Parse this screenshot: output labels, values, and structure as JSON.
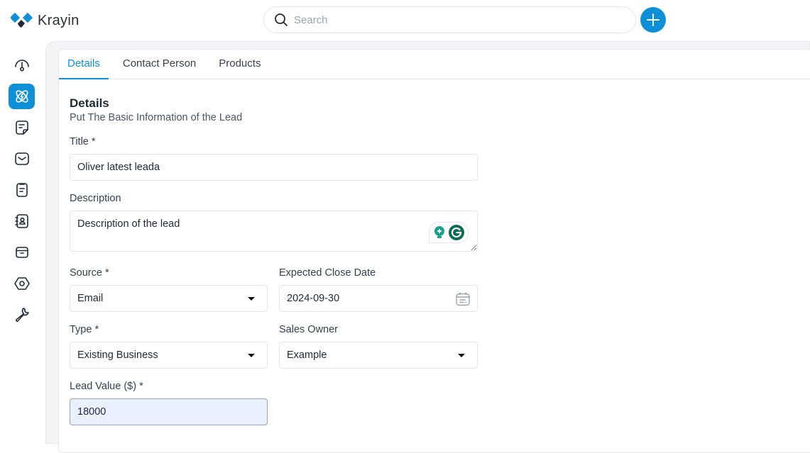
{
  "app": {
    "name": "Krayin"
  },
  "header": {
    "search_placeholder": "Search",
    "add_button": "plus-icon"
  },
  "sidebar": {
    "items": [
      {
        "name": "dashboard",
        "icon": "dashboard-gauge-icon",
        "active": false
      },
      {
        "name": "leads",
        "icon": "leads-atom-icon",
        "active": true
      },
      {
        "name": "quotes",
        "icon": "quote-note-icon",
        "active": false
      },
      {
        "name": "mail",
        "icon": "mail-icon",
        "active": false
      },
      {
        "name": "activities",
        "icon": "clipboard-icon",
        "active": false
      },
      {
        "name": "contacts",
        "icon": "contact-book-icon",
        "active": false
      },
      {
        "name": "products",
        "icon": "box-icon",
        "active": false
      },
      {
        "name": "settings",
        "icon": "settings-hex-icon",
        "active": false
      },
      {
        "name": "configuration",
        "icon": "wrench-icon",
        "active": false
      }
    ]
  },
  "tabs": [
    {
      "label": "Details",
      "active": true
    },
    {
      "label": "Contact Person",
      "active": false
    },
    {
      "label": "Products",
      "active": false
    }
  ],
  "section": {
    "title": "Details",
    "subtitle": "Put The Basic Information of the Lead"
  },
  "form": {
    "title": {
      "label": "Title *",
      "value": "Oliver latest leada"
    },
    "description": {
      "label": "Description",
      "value": "Description of the lead"
    },
    "source": {
      "label": "Source *",
      "value": "Email"
    },
    "expected_close_date": {
      "label": "Expected Close Date",
      "value": "2024-09-30"
    },
    "type": {
      "label": "Type *",
      "value": "Existing Business"
    },
    "sales_owner": {
      "label": "Sales Owner",
      "value": "Example"
    },
    "lead_value": {
      "label": "Lead Value ($) *",
      "value": "18000"
    }
  },
  "colors": {
    "accent": "#0e90d9",
    "grammarly": "#15a38b"
  }
}
